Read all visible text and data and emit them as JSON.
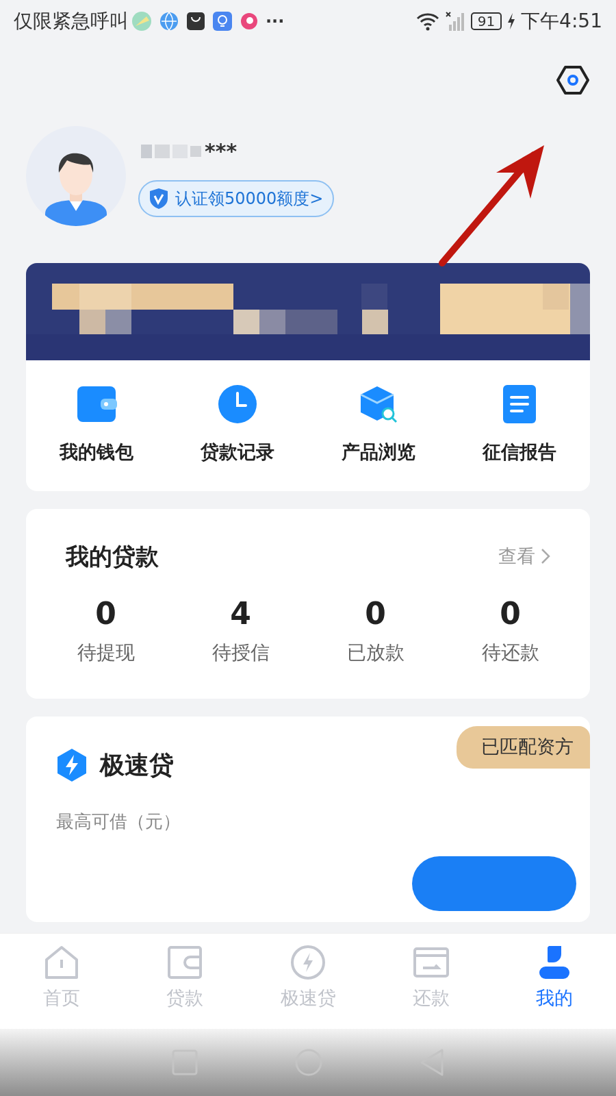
{
  "status_bar": {
    "carrier": "仅限紧急呼叫",
    "more": "···",
    "battery": "91",
    "time": "下午4:51"
  },
  "profile": {
    "masked_phone": "***",
    "badge": "认证领50000额度>"
  },
  "quick_actions": [
    {
      "label": "我的钱包",
      "kind": "wallet"
    },
    {
      "label": "贷款记录",
      "kind": "clock"
    },
    {
      "label": "产品浏览",
      "kind": "cube"
    },
    {
      "label": "征信报告",
      "kind": "doc"
    }
  ],
  "my_loans": {
    "title": "我的贷款",
    "link": "查看",
    "stats": [
      {
        "value": "0",
        "label": "待提现"
      },
      {
        "value": "4",
        "label": "待授信"
      },
      {
        "value": "0",
        "label": "已放款"
      },
      {
        "value": "0",
        "label": "待还款"
      }
    ]
  },
  "product": {
    "title": "极速贷",
    "tag": "已匹配资方",
    "subtitle": "最高可借（元）"
  },
  "tabs": [
    {
      "label": "首页",
      "kind": "home",
      "selected": false
    },
    {
      "label": "贷款",
      "kind": "wallet",
      "selected": false
    },
    {
      "label": "极速贷",
      "kind": "bolt",
      "selected": false
    },
    {
      "label": "还款",
      "kind": "card",
      "selected": false
    },
    {
      "label": "我的",
      "kind": "user",
      "selected": true
    }
  ]
}
